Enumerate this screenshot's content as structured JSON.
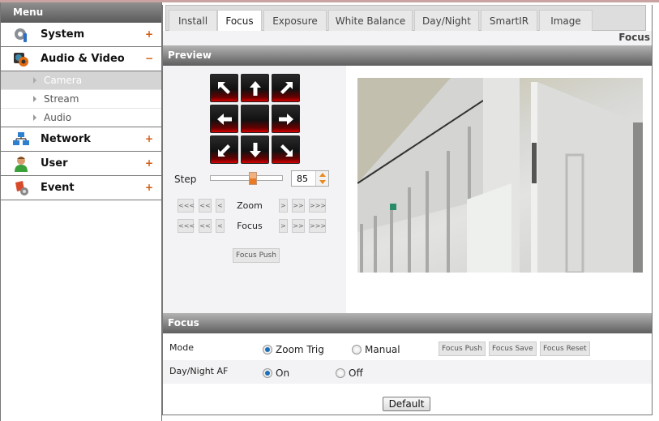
{
  "sidebar": {
    "title": "Menu",
    "items": [
      {
        "label": "System",
        "icon": "gear-icon",
        "toggle": "+"
      },
      {
        "label": "Audio & Video",
        "icon": "camera-icon",
        "toggle": "−"
      },
      {
        "label": "Network",
        "icon": "network-icon",
        "toggle": "+"
      },
      {
        "label": "User",
        "icon": "user-icon",
        "toggle": "+"
      },
      {
        "label": "Event",
        "icon": "event-icon",
        "toggle": "+"
      }
    ],
    "sub_items": [
      {
        "label": "Camera",
        "active": true
      },
      {
        "label": "Stream",
        "active": false
      },
      {
        "label": "Audio",
        "active": false
      }
    ]
  },
  "tabs": [
    {
      "label": "Install",
      "active": false
    },
    {
      "label": "Focus",
      "active": true
    },
    {
      "label": "Exposure",
      "active": false
    },
    {
      "label": "White Balance",
      "active": false
    },
    {
      "label": "Day/Night",
      "active": false
    },
    {
      "label": "SmartIR",
      "active": false
    },
    {
      "label": "Image",
      "active": false
    }
  ],
  "page_subtitle": "Focus",
  "preview": {
    "title": "Preview",
    "ptz_buttons": [
      "up-left",
      "up",
      "up-right",
      "left",
      "center",
      "right",
      "down-left",
      "down",
      "down-right"
    ],
    "step": {
      "label": "Step",
      "value": "85",
      "slider_fraction": 0.6
    },
    "zoom": {
      "label": "Zoom",
      "left": [
        "<<<",
        "<<",
        "<"
      ],
      "right": [
        ">",
        ">>",
        ">>>"
      ]
    },
    "focus": {
      "label": "Focus",
      "left": [
        "<<<",
        "<<",
        "<"
      ],
      "right": [
        ">",
        ">>",
        ">>>"
      ]
    },
    "focus_push_label": "Focus Push",
    "camera_image": "live-camera-preview"
  },
  "focus_section": {
    "title": "Focus",
    "mode": {
      "label": "Mode",
      "options": [
        {
          "label": "Zoom Trig",
          "checked": true
        },
        {
          "label": "Manual",
          "checked": false
        }
      ],
      "buttons": [
        "Focus Push",
        "Focus Save",
        "Focus Reset"
      ]
    },
    "daynight_af": {
      "label": "Day/Night AF",
      "options": [
        {
          "label": "On",
          "checked": true
        },
        {
          "label": "Off",
          "checked": false
        }
      ]
    }
  },
  "default_label": "Default",
  "colors": {
    "accent": "#d05a10",
    "radio_on": "#1d6fb8",
    "ptz_red": "#d80000"
  }
}
